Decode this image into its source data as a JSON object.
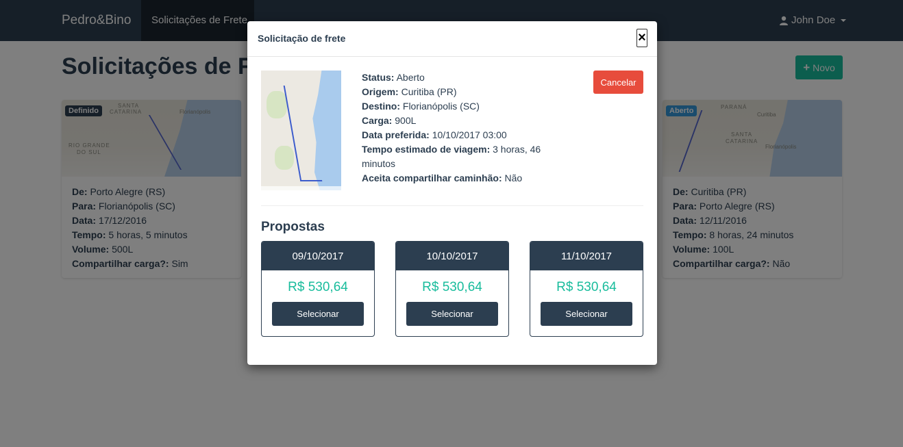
{
  "navbar": {
    "brand": "Pedro&Bino",
    "active_item": "Solicitações de Frete",
    "user_name": "John Doe"
  },
  "page": {
    "title": "Solicitações de Frete",
    "new_button": "Novo"
  },
  "cards": [
    {
      "badge": "Definido",
      "map_labels": [
        "SANTA",
        "CATARINA",
        "Florianópolis",
        "RIO GRANDE",
        "DO SUL"
      ],
      "rows": [
        {
          "label": "De:",
          "value": "Porto Alegre (RS)"
        },
        {
          "label": "Para:",
          "value": "Florianópolis (SC)"
        },
        {
          "label": "Data:",
          "value": "17/12/2016"
        },
        {
          "label": "Tempo:",
          "value": "5 horas, 5 minutos"
        },
        {
          "label": "Volume:",
          "value": "500L"
        },
        {
          "label": "Compartilhar carga?:",
          "value": "Sim"
        }
      ]
    },
    {
      "badge": "Aberto",
      "map_labels": [
        "PARANÁ",
        "Curitiba",
        "SANTA",
        "CATARINA",
        "Florianópolis"
      ],
      "rows": [
        {
          "label": "De:",
          "value": "Curitiba (PR)"
        },
        {
          "label": "Para:",
          "value": "Porto Alegre (RS)"
        },
        {
          "label": "Data:",
          "value": "12/11/2016"
        },
        {
          "label": "Tempo:",
          "value": "8 horas, 24 minutos"
        },
        {
          "label": "Volume:",
          "value": "100L"
        },
        {
          "label": "Compartilhar carga?:",
          "value": "Não"
        }
      ]
    }
  ],
  "modal": {
    "title": "Solicitação de frete",
    "close_symbol": "×",
    "cancel_button": "Cancelar",
    "details": [
      {
        "label": "Status:",
        "value": "Aberto"
      },
      {
        "label": "Origem:",
        "value": "Curitiba (PR)"
      },
      {
        "label": "Destino:",
        "value": "Florianópolis (SC)"
      },
      {
        "label": "Carga:",
        "value": "900L"
      },
      {
        "label": "Data preferida:",
        "value": "10/10/2017 03:00"
      },
      {
        "label": "Tempo estimado de viagem:",
        "value": "3 horas, 46 minutos"
      },
      {
        "label": "Aceita compartilhar caminhão:",
        "value": "Não"
      }
    ],
    "proposals_title": "Propostas",
    "proposals": [
      {
        "date": "09/10/2017",
        "price": "R$ 530,64",
        "button": "Selecionar"
      },
      {
        "date": "10/10/2017",
        "price": "R$ 530,64",
        "button": "Selecionar"
      },
      {
        "date": "11/10/2017",
        "price": "R$ 530,64",
        "button": "Selecionar"
      }
    ]
  },
  "colors": {
    "primary": "#2c3e50",
    "success": "#18bc9c",
    "danger": "#e74c3c",
    "info": "#3498db"
  }
}
